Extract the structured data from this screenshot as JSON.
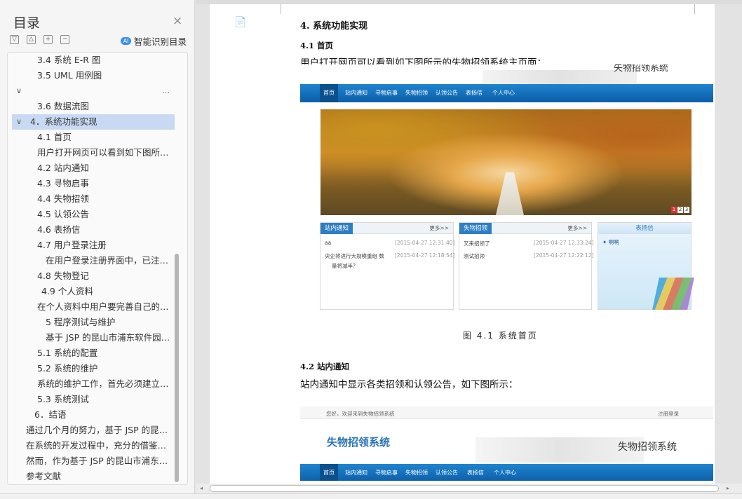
{
  "nav": {
    "title": "目录",
    "close_glyph": "×",
    "smart_toc": "智能识别目录",
    "smart_icon_glyph": "AI",
    "tools": [
      "▽",
      "△",
      "+",
      "−"
    ],
    "items": [
      "3.4 系统 E-R 图",
      "3.5 UML 用例图",
      "",
      "3.6 数据流图",
      "4．系统功能实现",
      "4.1 首页",
      "用户打开网页可以看到如下图所示的失物招领系统主页面：",
      "4.2 站内通知",
      "4.3 寻物启事",
      "4.4 失物招领",
      "4.5 认领公告",
      "4.6 表扬信",
      "4.7 用户登录注册",
      "在用户登录注册界面中，已注册的用户可以直接登录",
      "4.8 失物登记",
      "4.9 个人资料",
      "在个人资料中用户要完善自己的个人信息",
      "5 程序测试与维护",
      "基于 JSP 的昆山市浦东软件园失物招领系统",
      "5.1 系统的配置",
      "5.2 系统的维护",
      "系统的维护工作，首先必须建立完善的维护制度",
      "5.3 系统测试",
      "6．结语",
      "通过几个月的努力，基于 JSP 的昆山市浦东软件园失物招领系统",
      "在系统的开发过程中，充分的借鉴了他人的经验",
      "然而，作为基于 JSP 的昆山市浦东软件园失物招领系统",
      "参考文献"
    ],
    "more_glyph": "…",
    "collapse_glyph": "∨"
  },
  "doc": {
    "icon_glyph": "📄",
    "h1": "4. 系统功能实现",
    "h41": "4.1 首页",
    "p41": "用户打开网页可以看到如下图所示的失物招领系统主页面：",
    "fig41": "图 4.1 系统首页",
    "h42": "4.2 站内通知",
    "p42": "站内通知中显示各类招领和认领公告，如下图所示：",
    "shot1": {
      "site_title": "失物招领系统",
      "nav": [
        "首页",
        "站内通知",
        "寻物启事",
        "失物招领",
        "认领公告",
        "表扬信",
        "个人中心"
      ],
      "pages": [
        "1",
        "2",
        "3"
      ],
      "panel1": {
        "tab": "站内通知",
        "more": "更多>>",
        "rows": [
          "aa",
          "央企将进行大规模重组 数",
          "量将减半？"
        ],
        "dates": [
          "[2015-04-27 12:31:40]",
          "[2015-04-27 12:18:54]"
        ]
      },
      "panel2": {
        "tab": "失物招领",
        "more": "更多>>",
        "rows": [
          "又来招领了",
          "测试招领"
        ],
        "dates": [
          "[2015-04-27 12:33:24]",
          "[2015-04-27 12:22:12]"
        ]
      },
      "panel3": {
        "tab": "表扬信",
        "rows": [
          "✦ 啊啊"
        ]
      }
    },
    "shot2": {
      "welcome": "您好，欢迎来到失物招领系统",
      "login": "注册登录",
      "logo": "失物招领系统",
      "site_title": "失物招领系统",
      "nav": [
        "首页",
        "站内通知",
        "寻物启事",
        "失物招领",
        "认领公告",
        "表扬信",
        "个人中心"
      ]
    }
  },
  "scroll": {
    "left_glyph": "◂",
    "right_glyph": "▸"
  }
}
